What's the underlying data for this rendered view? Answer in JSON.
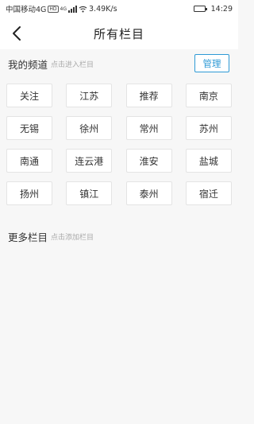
{
  "status_bar": {
    "carrier": "中国移动4G",
    "net_tag": "HD",
    "signal_tag": "4G",
    "speed": "3.49K/s",
    "time": "14:29",
    "battery_level": 0.9
  },
  "nav": {
    "title": "所有栏目"
  },
  "my_channels": {
    "title": "我的频道",
    "hint": "点击进入栏目",
    "manage_label": "管理",
    "items": [
      "关注",
      "江苏",
      "推荐",
      "南京",
      "无锡",
      "徐州",
      "常州",
      "苏州",
      "南通",
      "连云港",
      "淮安",
      "盐城",
      "扬州",
      "镇江",
      "泰州",
      "宿迁"
    ]
  },
  "more_channels": {
    "title": "更多栏目",
    "hint": "点击添加栏目"
  },
  "colors": {
    "accent": "#2e9ad6",
    "background": "#f7f7f7"
  }
}
